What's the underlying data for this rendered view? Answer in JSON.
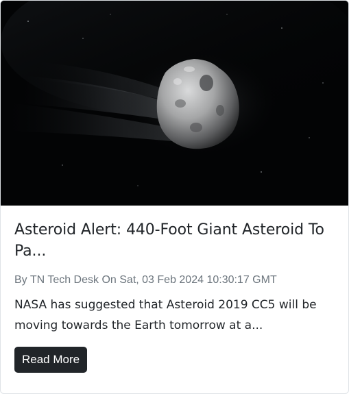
{
  "article": {
    "image_alt": "Asteroid in space",
    "title": "Asteroid Alert: 440-Foot Giant Asteroid To Pa...",
    "meta": "By TN Tech Desk On Sat, 03 Feb 2024 10:30:17 GMT",
    "excerpt": "NASA has suggested that Asteroid 2019 CC5 will be moving towards the Earth tomorrow at a...",
    "read_more_label": "Read More"
  },
  "colors": {
    "button_bg": "#212529",
    "title": "#212529",
    "meta": "#6c757d",
    "image_bg": "#030405"
  }
}
